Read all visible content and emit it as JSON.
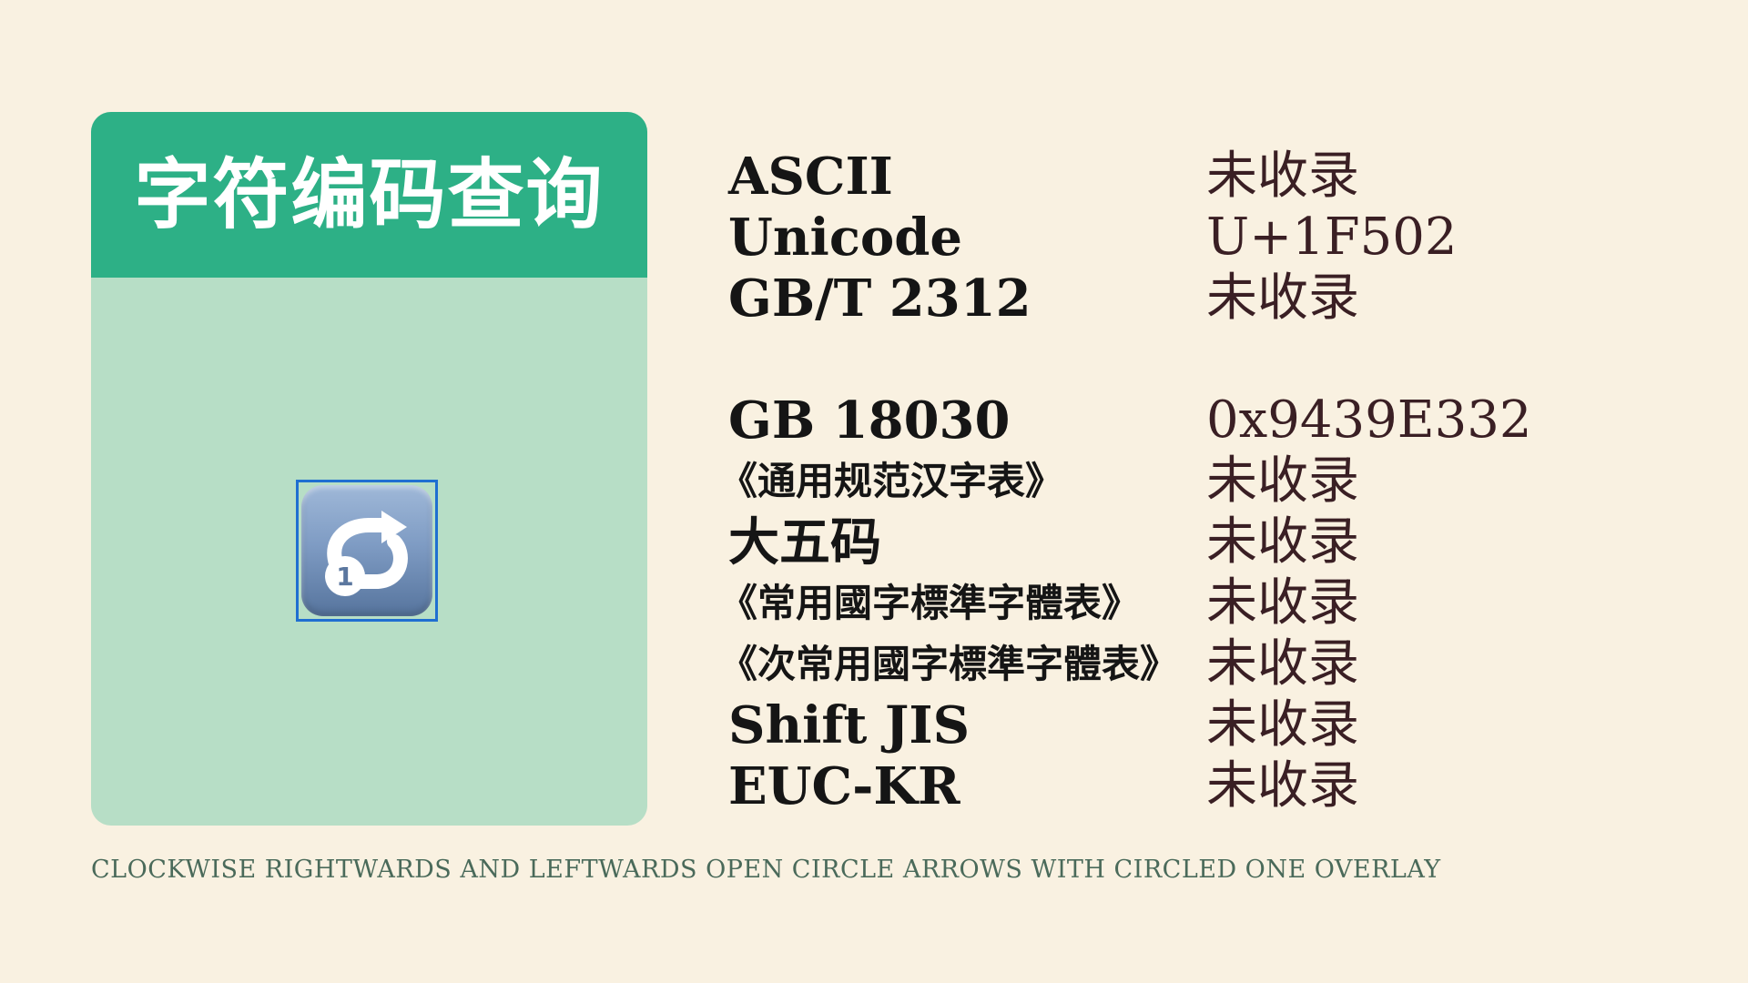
{
  "card": {
    "title": "字符编码查询",
    "glyph_icon": "clockwise-arrows-circled-one-icon",
    "glyph_overlay_digit": "1"
  },
  "rows": [
    {
      "label": "ASCII",
      "value": "未收录"
    },
    {
      "label": "Unicode",
      "value": "U+1F502"
    },
    {
      "label": "GB/T 2312",
      "value": "未收录"
    },
    {
      "label": "GB 18030",
      "value": "0x9439E332"
    },
    {
      "label": "《通用规范汉字表》",
      "value": "未收录"
    },
    {
      "label": "大五码",
      "value": "未收录"
    },
    {
      "label": "《常用國字標準字體表》",
      "value": "未收录"
    },
    {
      "label": "《次常用國字標準字體表》",
      "value": "未收录"
    },
    {
      "label": "Shift JIS",
      "value": "未收录"
    },
    {
      "label": "EUC-KR",
      "value": "未收录"
    }
  ],
  "footer": {
    "character_name": "CLOCKWISE RIGHTWARDS AND LEFTWARDS OPEN CIRCLE ARROWS WITH CIRCLED ONE OVERLAY"
  },
  "colors": {
    "background": "#f9f1e1",
    "header": "#2db086",
    "card_body": "#b7dec6",
    "label_text": "#151515",
    "value_text": "#3a1f24",
    "footer_text": "#4a6a5a"
  }
}
